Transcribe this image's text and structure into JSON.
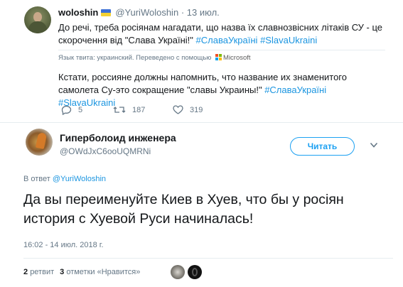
{
  "quoted_tweet": {
    "author_name": "woloshin",
    "author_handle": "@YuriWoloshin",
    "separator": "·",
    "date": "13 июл.",
    "text_prefix": "До речі, треба росіянам нагадати, що назва їх славнозвісних літаків СУ - це скорочення від \"Слава Україні!\" ",
    "hashtags": [
      "#СлаваУкраїні",
      "#SlavaUkraini"
    ],
    "translation_note": "Язык твита: украинский. Переведено с помощью",
    "translator_brand": "Microsoft",
    "translated_prefix": "Кстати, россияне должны напомнить, что название их знаменитого самолета Су-это сокращение \"славы Украины!\" ",
    "translated_hashtags": [
      "#СлаваУкраїні",
      "#SlavaUkraini"
    ],
    "actions": {
      "replies": "5",
      "retweets": "187",
      "likes": "319"
    }
  },
  "main_tweet": {
    "author_name": "Гиперболоид инженера",
    "author_handle": "@OWdJxC6ooUQMRNi",
    "follow_label": "Читать",
    "reply_prefix": "В ответ ",
    "reply_to": "@YuriWoloshin",
    "text": "Да вы переименуйте Киев в Хуев, что бы у росiян история с Хуевой Руси начиналась!",
    "timestamp": "16:02 - 14 июл. 2018 г.",
    "retweet_count": "2",
    "retweet_label": "ретвит",
    "like_count": "3",
    "like_label": "отметки «Нравится»"
  },
  "colors": {
    "accent": "#1da1f2",
    "hashtag": "#1b95e0",
    "secondary_text": "#657786",
    "like_icon": "#e0245e"
  },
  "icons": {
    "reply": "reply-icon",
    "retweet": "retweet-icon",
    "like": "heart-icon",
    "more": "chevron-down-icon"
  }
}
